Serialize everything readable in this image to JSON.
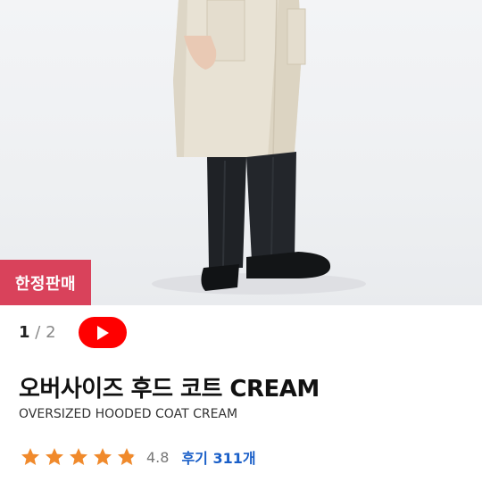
{
  "badge": {
    "label": "한정판매"
  },
  "pager": {
    "current": "1",
    "separator": "/",
    "total": "2"
  },
  "video": {
    "icon": "play-icon",
    "color": "#ff0000"
  },
  "product": {
    "title": "오버사이즈 후드 코트 CREAM",
    "subtitle": "OVERSIZED HOODED COAT CREAM"
  },
  "rating": {
    "stars": 4.8,
    "score": "4.8",
    "reviews_label": "후기 311개",
    "star_color": "#f08a2c"
  },
  "colors": {
    "badge": "#d9425b",
    "link": "#1a5fc8"
  }
}
